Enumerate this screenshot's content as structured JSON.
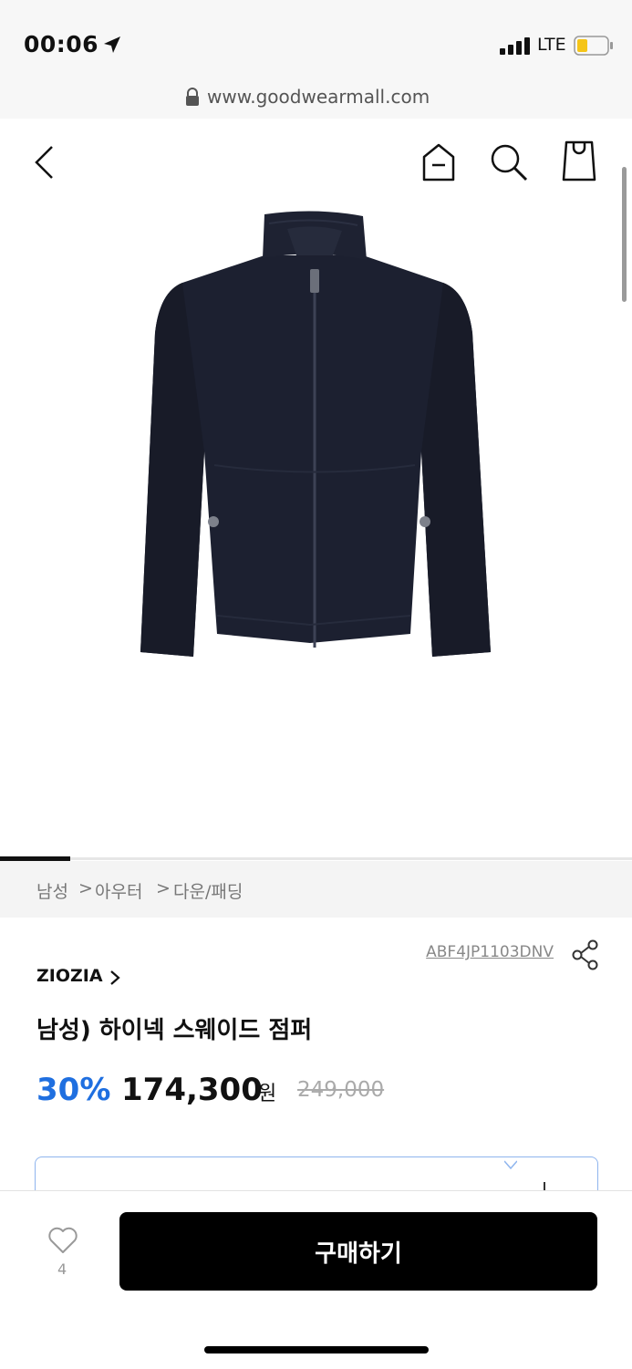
{
  "status": {
    "time": "00:06",
    "network": "LTE",
    "location_icon": "location-arrow-icon",
    "signal_icon": "signal-bars-icon",
    "battery_icon": "battery-low-icon",
    "battery_color": "#f5c518"
  },
  "browser": {
    "url": "www.goodwearmall.com",
    "lock_icon": "lock-icon"
  },
  "nav": {
    "back_icon": "chevron-left-icon",
    "home_icon": "home-icon",
    "search_icon": "search-icon",
    "bag_icon": "shopping-bag-icon"
  },
  "gallery": {
    "image_alt": "navy suede high-neck zip jacket",
    "active_slide": 1
  },
  "breadcrumb": [
    "남성",
    "아우터",
    "다운/패딩"
  ],
  "breadcrumb_separator": ">",
  "product": {
    "code": "ABF4JP1103DNV",
    "brand": "ZIOZIA",
    "brand_chevron": ">",
    "title": "남성) 하이넥 스웨이드 점퍼",
    "discount": "30%",
    "price": "174,300",
    "currency": "원",
    "original_price": "249,000"
  },
  "colors": {
    "accent_blue": "#1f6fe0",
    "buy_bg": "#000000"
  },
  "bottom": {
    "like_count": "4",
    "buy_label": "구매하기"
  }
}
